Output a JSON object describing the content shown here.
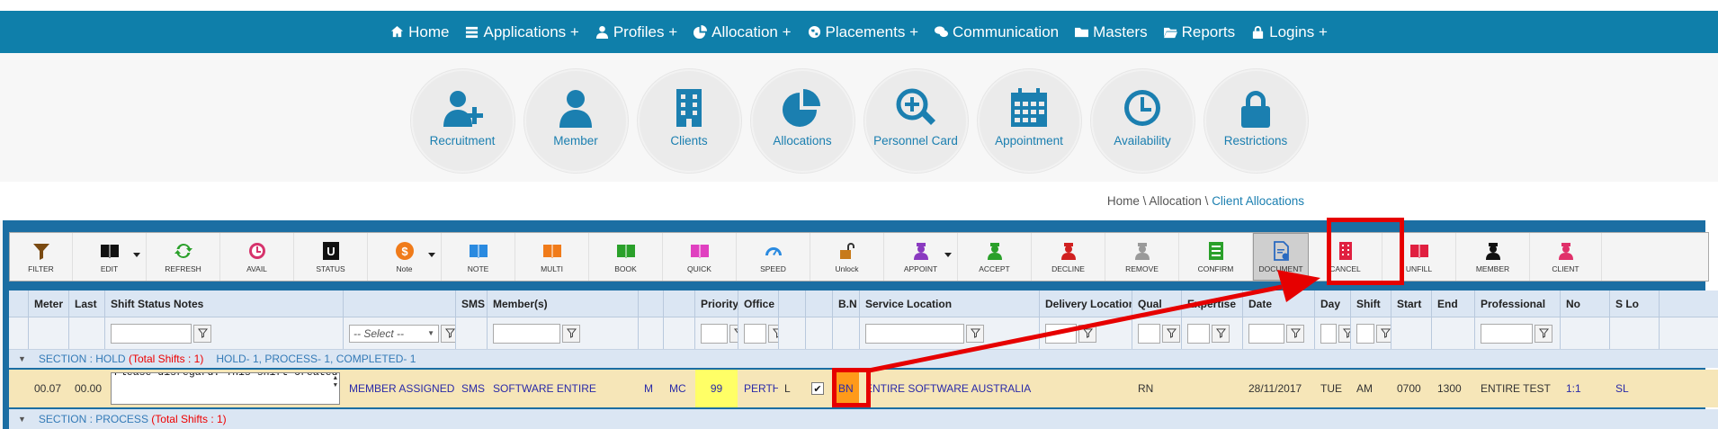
{
  "nav": [
    {
      "label": "Home",
      "icon": "home-icon"
    },
    {
      "label": "Applications +",
      "icon": "list-icon"
    },
    {
      "label": "Profiles +",
      "icon": "user-icon"
    },
    {
      "label": "Allocation +",
      "icon": "pie-icon"
    },
    {
      "label": "Placements +",
      "icon": "globe-icon"
    },
    {
      "label": "Communication",
      "icon": "chat-icon"
    },
    {
      "label": "Masters",
      "icon": "folder-icon"
    },
    {
      "label": "Reports",
      "icon": "folder-open-icon"
    },
    {
      "label": "Logins +",
      "icon": "lock-icon"
    }
  ],
  "tiles": [
    {
      "label": "Recruitment",
      "icon": "user-plus-icon"
    },
    {
      "label": "Member",
      "icon": "user-icon"
    },
    {
      "label": "Clients",
      "icon": "building-icon"
    },
    {
      "label": "Allocations",
      "icon": "pie-chart-icon"
    },
    {
      "label": "Personnel Card",
      "icon": "search-plus-icon"
    },
    {
      "label": "Appointment",
      "icon": "calendar-icon"
    },
    {
      "label": "Availability",
      "icon": "clock-icon"
    },
    {
      "label": "Restrictions",
      "icon": "lock-icon"
    }
  ],
  "breadcrumb": {
    "home": "Home",
    "sep1": " \\ ",
    "section": "Allocation",
    "sep2": " \\ ",
    "current": "Client Allocations"
  },
  "toolbar": [
    {
      "label": "FILTER",
      "icon": "filter-icon",
      "color": "#7a4a12"
    },
    {
      "label": "EDIT",
      "icon": "book-icon",
      "color": "#111111",
      "caret": true
    },
    {
      "label": "REFRESH",
      "icon": "refresh-icon",
      "color": "#2aa02a"
    },
    {
      "label": "AVAIL",
      "icon": "clock-icon",
      "color": "#d6336c"
    },
    {
      "label": "STATUS",
      "icon": "u-icon",
      "color": "#111111"
    },
    {
      "label": "Note",
      "icon": "dollar-icon",
      "color": "#f07b1a",
      "caret": true
    },
    {
      "label": "NOTE",
      "icon": "book-icon",
      "color": "#2a8ae0"
    },
    {
      "label": "MULTI",
      "icon": "book-icon",
      "color": "#f07b1a"
    },
    {
      "label": "BOOK",
      "icon": "book-icon",
      "color": "#2aa02a"
    },
    {
      "label": "QUICK",
      "icon": "book-icon",
      "color": "#e040c0"
    },
    {
      "label": "SPEED",
      "icon": "gauge-icon",
      "color": "#2a8ae0"
    },
    {
      "label": "Unlock",
      "icon": "unlock-icon",
      "color": "#c77a1a"
    },
    {
      "label": "APPOINT",
      "icon": "nurse-icon",
      "color": "#8a3ac0",
      "caret": true
    },
    {
      "label": "ACCEPT",
      "icon": "nurse-icon",
      "color": "#2aa02a"
    },
    {
      "label": "DECLINE",
      "icon": "nurse-icon",
      "color": "#d02020"
    },
    {
      "label": "REMOVE",
      "icon": "nurse-icon",
      "color": "#9a9a9a"
    },
    {
      "label": "CONFIRM",
      "icon": "list-icon",
      "color": "#2aa02a"
    },
    {
      "label": "DOCUMENT",
      "icon": "document-icon",
      "color": "#2a6ac0",
      "selected": true
    },
    {
      "label": "CANCEL",
      "icon": "building-icon",
      "color": "#e02040"
    },
    {
      "label": "UNFILL",
      "icon": "book-icon",
      "color": "#e02040"
    },
    {
      "label": "MEMBER",
      "icon": "nurse-icon",
      "color": "#111111"
    },
    {
      "label": "CLIENT",
      "icon": "nurse-icon",
      "color": "#e0306a"
    }
  ],
  "columns": [
    "",
    "Meter",
    "Last",
    "Shift Status Notes",
    "",
    "SMS",
    "Member(s)",
    "",
    "",
    "Priority",
    "Office",
    "",
    "",
    "B.N",
    "Service Location",
    "Delivery Location",
    "Qual",
    "Expertise",
    "Date",
    "Day",
    "Shift",
    "Start",
    "End",
    "Professional",
    "No",
    "S Lo"
  ],
  "filters": {
    "select_placeholder": "-- Select --"
  },
  "sections": {
    "hold": {
      "label": "SECTION : HOLD",
      "total": "(Total Shifts : 1)",
      "summary": "HOLD- 1, PROCESS- 1, COMPLETED- 1"
    },
    "process": {
      "label": "SECTION : PROCESS",
      "total": "(Total Shifts : 1)"
    }
  },
  "row": {
    "meter": "00.07",
    "last": "00.00",
    "notes": "Please disregard. This shift created by Entire for testing purposes.",
    "status": "MEMBER ASSIGNED",
    "sms": "SMS",
    "member": "SOFTWARE ENTIRE",
    "m": "M",
    "mc": "MC",
    "priority": "99",
    "office": "PERTH",
    "l": "L",
    "checked": "✔",
    "bn": "BN",
    "service_location": "ENTIRE SOFTWARE AUSTRALIA",
    "delivery_location": "",
    "qual": "RN",
    "expertise": "",
    "date": "28/11/2017",
    "day": "TUE",
    "shift": "AM",
    "start": "0700",
    "end": "1300",
    "professional": "ENTIRE TEST",
    "no": "1:1",
    "slo": "SL"
  },
  "colors": {
    "nav": "#0f7faa",
    "accent": "#1b7fb0",
    "row": "#f6e6b8",
    "priority": "#ffff66",
    "bn": "#ff9a1a",
    "highlight": "#e60000"
  }
}
